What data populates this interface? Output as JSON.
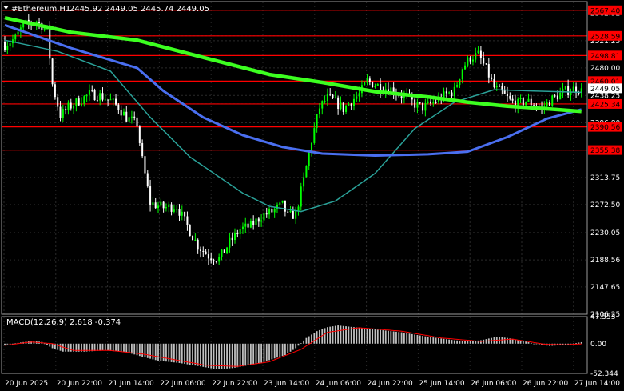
{
  "header": {
    "symbol": "#Ethereum,H1",
    "ohlc": "2445.92 2449.05 2445.74 2449.05",
    "menu_icon": "triangle-down-icon"
  },
  "macd_header": "MACD(12,26,9) 2.618 -0.374",
  "colors": {
    "background": "#000000",
    "bull": "#00ff00",
    "bear": "#ffffff",
    "level_line": "#ff0000",
    "ma_fast": "#2aa198",
    "ma_mid": "#4a6ff0",
    "ma_slow": "#3cff20",
    "macd_hist": "#c0c0c0",
    "macd_signal": "#ff0000",
    "grid": "#2a2a2a",
    "frame": "#9a9a9a"
  },
  "chart_data": {
    "type": "candlestick",
    "symbol": "#Ethereum",
    "timeframe": "H1",
    "ylim": [
      2106.25,
      2580.5
    ],
    "price_ticks": [
      2106.25,
      2147.65,
      2188.56,
      2230.05,
      2272.5,
      2313.75,
      2355.38,
      2396.8,
      2425.34,
      2438.25,
      2460.01,
      2480.0,
      2498.81,
      2521.25,
      2528.59,
      2567.4
    ],
    "axis_labels": [
      "2562.92",
      "2521.25",
      "2480.00",
      "2438.25",
      "2396.80",
      "2355.38",
      "2313.75",
      "2272.50",
      "2230.05",
      "2188.56",
      "2147.65",
      "2106.25"
    ],
    "current_price": 2449.05,
    "time_labels": [
      "20 Jun 2025",
      "20 Jun 22:00",
      "21 Jun 14:00",
      "22 Jun 06:00",
      "22 Jun 22:00",
      "23 Jun 14:00",
      "24 Jun 06:00",
      "24 Jun 22:00",
      "25 Jun 14:00",
      "26 Jun 06:00",
      "26 Jun 22:00",
      "27 Jun 14:00"
    ],
    "levels": [
      {
        "label": "2567.40",
        "value": 2567.4
      },
      {
        "label": "2528.59",
        "value": 2528.59
      },
      {
        "label": "2498.81",
        "value": 2498.81
      },
      {
        "label": "2460.01",
        "value": 2460.01
      },
      {
        "label": "2425.34",
        "value": 2425.34
      },
      {
        "label": "2390.56",
        "value": 2390.56
      },
      {
        "label": "2355.38",
        "value": 2355.38
      }
    ],
    "path_anchors": [
      [
        0,
        2515
      ],
      [
        4,
        2525
      ],
      [
        7,
        2545
      ],
      [
        12,
        2550
      ],
      [
        16,
        2538
      ],
      [
        18,
        2455
      ],
      [
        21,
        2408
      ],
      [
        24,
        2420
      ],
      [
        28,
        2430
      ],
      [
        32,
        2440
      ],
      [
        36,
        2438
      ],
      [
        40,
        2430
      ],
      [
        43,
        2420
      ],
      [
        46,
        2405
      ],
      [
        50,
        2395
      ],
      [
        52,
        2340
      ],
      [
        55,
        2275
      ],
      [
        60,
        2268
      ],
      [
        65,
        2270
      ],
      [
        69,
        2240
      ],
      [
        73,
        2210
      ],
      [
        77,
        2195
      ],
      [
        81,
        2190
      ],
      [
        85,
        2215
      ],
      [
        89,
        2235
      ],
      [
        93,
        2240
      ],
      [
        97,
        2255
      ],
      [
        101,
        2262
      ],
      [
        105,
        2272
      ],
      [
        107,
        2255
      ],
      [
        110,
        2258
      ],
      [
        113,
        2310
      ],
      [
        116,
        2370
      ],
      [
        119,
        2420
      ],
      [
        122,
        2435
      ],
      [
        125,
        2428
      ],
      [
        128,
        2418
      ],
      [
        131,
        2430
      ],
      [
        134,
        2440
      ],
      [
        137,
        2460
      ],
      [
        140,
        2455
      ],
      [
        143,
        2450
      ],
      [
        146,
        2448
      ],
      [
        149,
        2440
      ],
      [
        152,
        2436
      ],
      [
        155,
        2425
      ],
      [
        158,
        2420
      ],
      [
        161,
        2425
      ],
      [
        164,
        2432
      ],
      [
        167,
        2440
      ],
      [
        170,
        2445
      ],
      [
        173,
        2480
      ],
      [
        176,
        2496
      ],
      [
        179,
        2500
      ],
      [
        182,
        2478
      ],
      [
        185,
        2450
      ],
      [
        188,
        2442
      ],
      [
        191,
        2430
      ],
      [
        194,
        2425
      ],
      [
        197,
        2430
      ],
      [
        200,
        2425
      ],
      [
        203,
        2418
      ],
      [
        206,
        2430
      ],
      [
        209,
        2438
      ],
      [
        212,
        2445
      ],
      [
        215,
        2448
      ],
      [
        218,
        2449.05
      ]
    ],
    "moving_averages": [
      {
        "name": "ma_slow",
        "points": [
          [
            0,
            2556
          ],
          [
            25,
            2534
          ],
          [
            50,
            2522
          ],
          [
            75,
            2496
          ],
          [
            100,
            2470
          ],
          [
            120,
            2458
          ],
          [
            140,
            2444
          ],
          [
            160,
            2436
          ],
          [
            175,
            2428
          ],
          [
            190,
            2422
          ],
          [
            205,
            2418
          ],
          [
            218,
            2414
          ]
        ]
      },
      {
        "name": "ma_mid",
        "points": [
          [
            0,
            2545
          ],
          [
            25,
            2510
          ],
          [
            50,
            2480
          ],
          [
            60,
            2445
          ],
          [
            75,
            2405
          ],
          [
            90,
            2378
          ],
          [
            105,
            2360
          ],
          [
            120,
            2350
          ],
          [
            140,
            2347
          ],
          [
            160,
            2349
          ],
          [
            175,
            2353
          ],
          [
            190,
            2375
          ],
          [
            205,
            2403
          ],
          [
            218,
            2417
          ]
        ]
      },
      {
        "name": "ma_fast",
        "points": [
          [
            0,
            2522
          ],
          [
            20,
            2505
          ],
          [
            40,
            2475
          ],
          [
            55,
            2405
          ],
          [
            70,
            2345
          ],
          [
            90,
            2290
          ],
          [
            100,
            2270
          ],
          [
            112,
            2262
          ],
          [
            125,
            2278
          ],
          [
            140,
            2320
          ],
          [
            155,
            2388
          ],
          [
            170,
            2428
          ],
          [
            185,
            2447
          ],
          [
            200,
            2445
          ],
          [
            218,
            2443
          ]
        ]
      }
    ],
    "macd": {
      "ylim": [
        -52.344,
        47.553
      ],
      "ticks": [
        "47.553",
        "0.00",
        "-52.344"
      ],
      "histogram_anchors": [
        [
          0,
          -2
        ],
        [
          6,
          2
        ],
        [
          10,
          5
        ],
        [
          14,
          3
        ],
        [
          18,
          -8
        ],
        [
          22,
          -14
        ],
        [
          30,
          -14
        ],
        [
          38,
          -12
        ],
        [
          46,
          -15
        ],
        [
          52,
          -23
        ],
        [
          58,
          -30
        ],
        [
          66,
          -34
        ],
        [
          74,
          -40
        ],
        [
          80,
          -45
        ],
        [
          86,
          -43
        ],
        [
          96,
          -35
        ],
        [
          106,
          -20
        ],
        [
          110,
          -8
        ],
        [
          114,
          10
        ],
        [
          118,
          22
        ],
        [
          122,
          29
        ],
        [
          126,
          32
        ],
        [
          132,
          29
        ],
        [
          140,
          25
        ],
        [
          150,
          20
        ],
        [
          160,
          12
        ],
        [
          170,
          6
        ],
        [
          176,
          4
        ],
        [
          180,
          6
        ],
        [
          186,
          12
        ],
        [
          190,
          10
        ],
        [
          196,
          5
        ],
        [
          200,
          0
        ],
        [
          206,
          -4
        ],
        [
          212,
          -2
        ],
        [
          218,
          2.618
        ]
      ],
      "signal_anchors": [
        [
          0,
          -3
        ],
        [
          10,
          3
        ],
        [
          18,
          0
        ],
        [
          26,
          -12
        ],
        [
          40,
          -12
        ],
        [
          52,
          -18
        ],
        [
          64,
          -28
        ],
        [
          76,
          -38
        ],
        [
          88,
          -40
        ],
        [
          100,
          -32
        ],
        [
          112,
          -10
        ],
        [
          122,
          20
        ],
        [
          134,
          28
        ],
        [
          150,
          22
        ],
        [
          165,
          10
        ],
        [
          180,
          4
        ],
        [
          192,
          8
        ],
        [
          204,
          -1
        ],
        [
          212,
          -2
        ],
        [
          218,
          -0.374
        ]
      ]
    }
  }
}
